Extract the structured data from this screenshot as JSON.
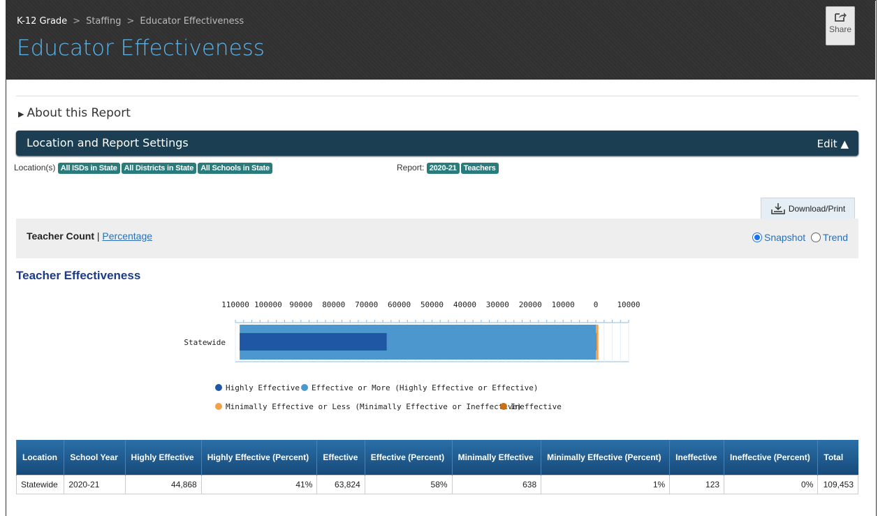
{
  "header": {
    "breadcrumbs": [
      "K-12 Grade",
      "Staffing",
      "Educator Effectiveness"
    ],
    "title": "Educator Effectiveness",
    "share_label": "Share"
  },
  "about_label": "About this Report",
  "settings": {
    "title": "Location and Report Settings",
    "edit_label": "Edit ▲",
    "locations_label": "Location(s)",
    "locations": [
      "All ISDs in State",
      "All Districts in State",
      "All Schools in State"
    ],
    "report_label": "Report:",
    "report_tags": [
      "2020-21",
      "Teachers"
    ]
  },
  "download_label": "Download/Print",
  "toolbar": {
    "count_label": "Teacher Count",
    "percentage_label": "Percentage",
    "snapshot_label": "Snapshot",
    "trend_label": "Trend"
  },
  "chart_data": {
    "type": "bar",
    "title": "Teacher Effectiveness",
    "categories": [
      "Statewide"
    ],
    "x_tick_labels": [
      "110000",
      "100000",
      "90000",
      "80000",
      "70000",
      "60000",
      "50000",
      "40000",
      "30000",
      "20000",
      "10000",
      "0",
      "10000"
    ],
    "x_range": [
      -110000,
      10000
    ],
    "series": [
      {
        "name": "Highly Effective",
        "values": [
          44868
        ],
        "color": "#1f57a4"
      },
      {
        "name": "Effective or More (Highly Effective or Effective)",
        "values": [
          108692
        ],
        "color": "#4d97cf"
      },
      {
        "name": "Minimally Effective or Less (Minimally Effective or Ineffective)",
        "values": [
          761
        ],
        "color": "#f5a04a"
      },
      {
        "name": "Ineffective",
        "values": [
          123
        ],
        "color": "#c96f14"
      }
    ]
  },
  "table": {
    "headers": [
      "Location",
      "School Year",
      "Highly Effective",
      "Highly Effective (Percent)",
      "Effective",
      "Effective (Percent)",
      "Minimally Effective",
      "Minimally Effective (Percent)",
      "Ineffective",
      "Ineffective (Percent)",
      "Total"
    ],
    "rows": [
      [
        "Statewide",
        "2020-21",
        "44,868",
        "41%",
        "63,824",
        "58%",
        "638",
        "1%",
        "123",
        "0%",
        "109,453"
      ]
    ]
  }
}
